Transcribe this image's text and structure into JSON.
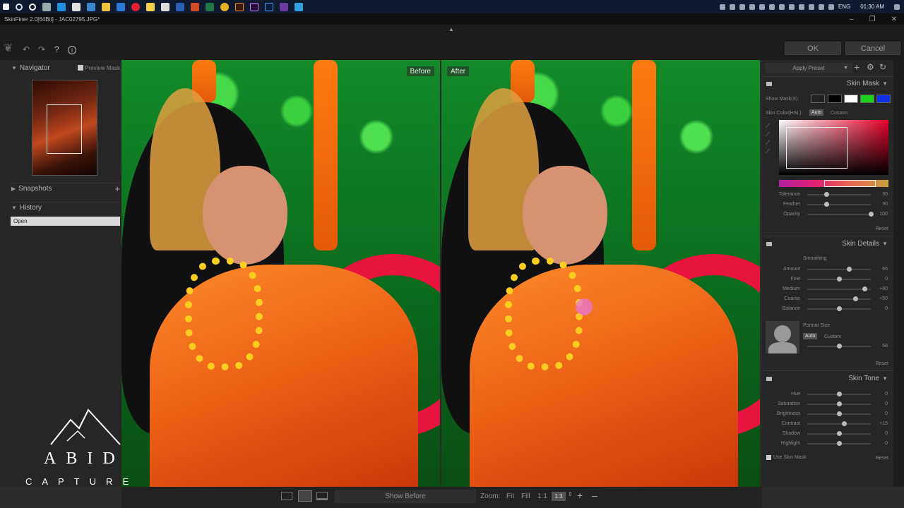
{
  "taskbar": {
    "lang": "ENG",
    "time": "01:30 AM"
  },
  "window": {
    "title": "SkinFiner 2.0[64Bit] - JAC02795.JPG*"
  },
  "toolbar": {
    "ok_label": "OK",
    "cancel_label": "Cancel"
  },
  "left": {
    "navigator_label": "Navigator",
    "preview_mask_label": "Preview Mask",
    "snapshots_label": "Snapshots",
    "history_label": "History",
    "history_items": [
      "Open"
    ]
  },
  "view": {
    "before_label": "Before",
    "after_label": "After"
  },
  "right": {
    "preset_label": "Apply Preset",
    "skin_mask": {
      "title": "Skin Mask",
      "show_mask_label": "Show Mask(X):",
      "skin_color_label": "Skin Color(HSL):",
      "auto_label": "Auto",
      "custom_label": "Custom",
      "sliders": [
        {
          "label": "Tolerance",
          "value": "30",
          "pos": 0.3
        },
        {
          "label": "Feather",
          "value": "30",
          "pos": 0.3
        },
        {
          "label": "Opacity",
          "value": "100",
          "pos": 1.0
        }
      ],
      "reset_label": "Reset"
    },
    "skin_details": {
      "title": "Skin Details",
      "smoothing_label": "Smoothing",
      "sliders": [
        {
          "label": "Amount",
          "value": "65",
          "pos": 0.65
        },
        {
          "label": "Fine",
          "value": "0",
          "pos": 0.5
        },
        {
          "label": "Medium",
          "value": "+80",
          "pos": 0.9
        },
        {
          "label": "Coarse",
          "value": "+50",
          "pos": 0.75
        },
        {
          "label": "Balance",
          "value": "0",
          "pos": 0.5
        }
      ],
      "portrait_size_label": "Portrait Size",
      "auto_label": "Auto",
      "custom_label": "Custom",
      "portrait_value": "58",
      "portrait_pos": 0.5,
      "reset_label": "Reset"
    },
    "skin_tone": {
      "title": "Skin Tone",
      "sliders": [
        {
          "label": "Hue",
          "value": "0",
          "pos": 0.5
        },
        {
          "label": "Saturation",
          "value": "0",
          "pos": 0.5
        },
        {
          "label": "Brightness",
          "value": "0",
          "pos": 0.5
        },
        {
          "label": "Contrast",
          "value": "+15",
          "pos": 0.58
        },
        {
          "label": "Shadow",
          "value": "0",
          "pos": 0.5
        },
        {
          "label": "Highlight",
          "value": "0",
          "pos": 0.5
        }
      ],
      "use_skin_mask_label": "Use Skin Mask",
      "reset_label": "Reset"
    }
  },
  "bottom": {
    "show_before_label": "Show Before",
    "zoom_label": "Zoom:",
    "fit_label": "Fit",
    "fill_label": "Fill",
    "one_to_one_label": "1:1",
    "zoom_value": "1:3"
  },
  "watermark": {
    "brand": "ABID",
    "sub": "CAPTURE"
  },
  "colors": {
    "accent": "#e8133e",
    "panel": "#262626",
    "toolbar": "#1c1c1c"
  }
}
